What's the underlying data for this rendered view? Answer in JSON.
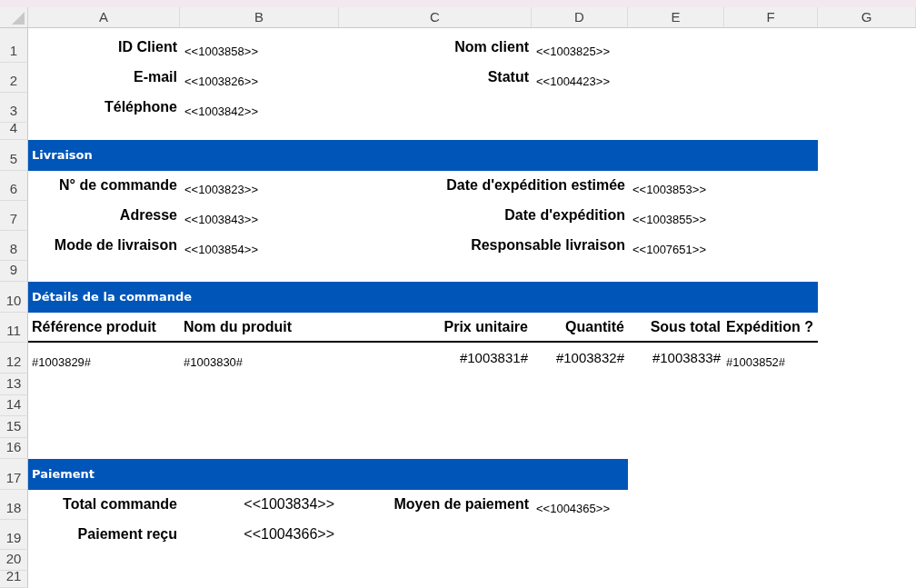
{
  "columns": [
    "A",
    "B",
    "C",
    "D",
    "E",
    "F",
    "G"
  ],
  "rows": [
    {
      "number": "1",
      "kind": "fields",
      "label_1": "ID Client",
      "value_1": "<<1003858>>",
      "label_2": "Nom client",
      "value_2": "<<1003825>>"
    },
    {
      "number": "2",
      "kind": "fields",
      "label_1": "E-mail",
      "value_1": "<<1003826>>",
      "label_2": "Statut",
      "value_2": "<<1004423>>"
    },
    {
      "number": "3",
      "kind": "fields",
      "label_1": "Téléphone",
      "value_1": "<<1003842>>"
    },
    {
      "number": "4",
      "kind": "empty"
    },
    {
      "number": "5",
      "kind": "section",
      "title": "Livraison"
    },
    {
      "number": "6",
      "kind": "fields_wide",
      "label_1": "N° de commande",
      "value_1": "<<1003823>>",
      "label_2": "Date d'expédition estimée",
      "value_2": "<<1003853>>"
    },
    {
      "number": "7",
      "kind": "fields_wide",
      "label_1": "Adresse",
      "value_1": "<<1003843>>",
      "label_2": "Date d'expédition",
      "value_2": "<<1003855>>"
    },
    {
      "number": "8",
      "kind": "fields_wide",
      "label_1": "Mode de livraison",
      "value_1": "<<1003854>>",
      "label_2": "Responsable livraison",
      "value_2": "<<1007651>>"
    },
    {
      "number": "9",
      "kind": "empty"
    },
    {
      "number": "10",
      "kind": "section",
      "title": "Détails de la commande"
    },
    {
      "number": "11",
      "kind": "header",
      "cells": [
        "Référence produit",
        "Nom du produit",
        "Prix unitaire",
        "Quantité",
        "Sous total",
        "Expédition ?"
      ]
    },
    {
      "number": "12",
      "kind": "data",
      "cells": [
        "#1003829#",
        "#1003830#",
        "#1003831#",
        "#1003832#",
        "#1003833#",
        "#1003852#"
      ]
    },
    {
      "number": "13",
      "kind": "empty"
    },
    {
      "number": "14",
      "kind": "empty"
    },
    {
      "number": "15",
      "kind": "empty"
    },
    {
      "number": "16",
      "kind": "empty"
    },
    {
      "number": "17",
      "kind": "section_short",
      "title": "Paiement"
    },
    {
      "number": "18",
      "kind": "payment",
      "label_1": "Total commande",
      "value_1": "<<1003834>>",
      "label_2": "Moyen de paiement",
      "value_2": "<<1004365>>"
    },
    {
      "number": "19",
      "kind": "payment",
      "label_1": "Paiement reçu",
      "value_1": "<<1004366>>"
    },
    {
      "number": "20",
      "kind": "empty"
    },
    {
      "number": "21",
      "kind": "empty"
    }
  ]
}
